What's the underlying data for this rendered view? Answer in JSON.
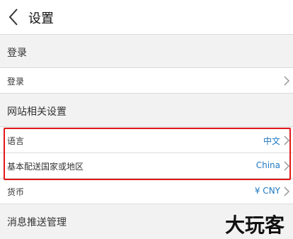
{
  "header": {
    "title": "设置",
    "back_icon": "chevron-left-icon"
  },
  "sections": {
    "login_header": "登录",
    "site_header": "网站相关设置",
    "push_header": "消息推送管理"
  },
  "rows": {
    "login": {
      "label": "登录",
      "value": ""
    },
    "language": {
      "label": "语言",
      "value": "中文"
    },
    "ship_to": {
      "label": "基本配送国家或地区",
      "value": "China"
    },
    "currency": {
      "label": "货币",
      "value": "¥ CNY"
    }
  },
  "colors": {
    "value_blue": "#1f78c1",
    "highlight_red": "#e01818",
    "divider": "#dcdcdc",
    "section_bg": "#f2f2f2"
  },
  "watermark": {
    "text": "大玩客"
  }
}
